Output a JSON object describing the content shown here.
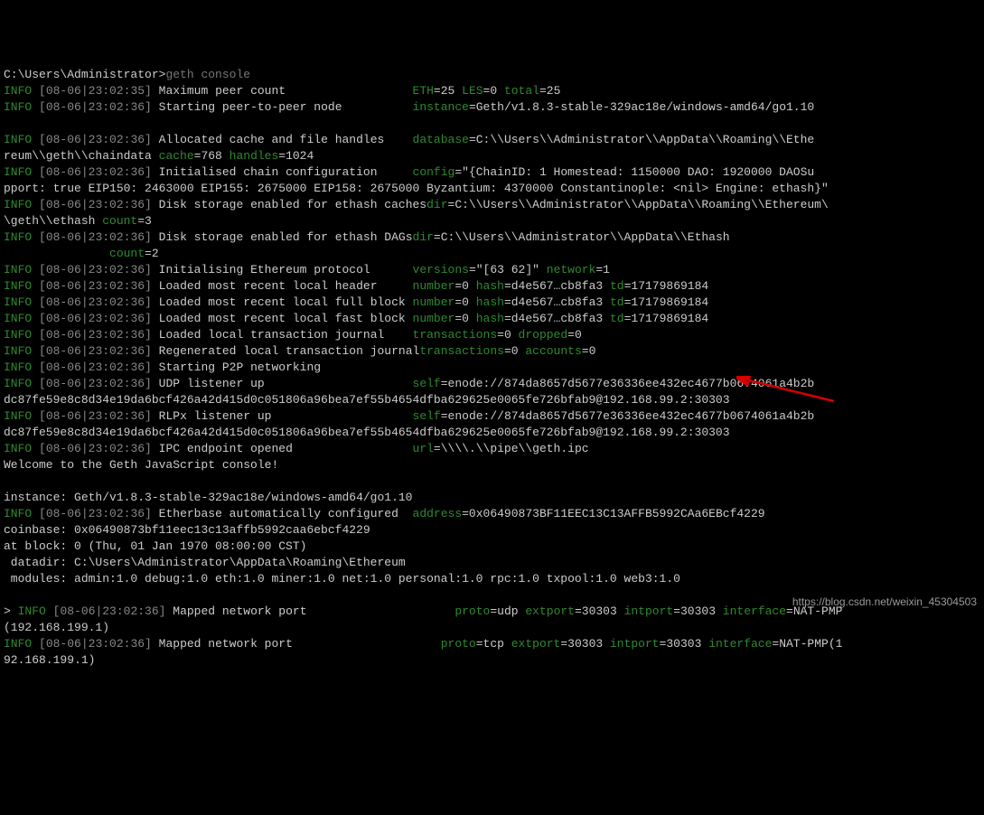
{
  "prompt": "C:\\Users\\Administrator>",
  "command": "geth console",
  "lines": [
    {
      "lvl": "INFO",
      "ts": "[08-06|23:02:35]",
      "msg": "Maximum peer count",
      "pad": 36,
      "kv": [
        [
          "ETH",
          "25"
        ],
        [
          "LES",
          "0"
        ],
        [
          "total",
          "25"
        ]
      ]
    },
    {
      "lvl": "INFO",
      "ts": "[08-06|23:02:36]",
      "msg": "Starting peer-to-peer node",
      "pad": 36,
      "kv": [
        [
          "instance",
          "Geth/v1.8.3-stable-329ac18e/windows-amd64/go1.10"
        ]
      ]
    },
    {
      "blank": true
    },
    {
      "lvl": "INFO",
      "ts": "[08-06|23:02:36]",
      "msg": "Allocated cache and file handles",
      "pad": 36,
      "kv": [
        [
          "database",
          "C:\\\\Users\\\\Administrator\\\\AppData\\\\Roaming\\\\Ethe"
        ]
      ],
      "wrap": "reum\\\\geth\\\\chaindata ",
      "wrapkv": [
        [
          "cache",
          "768"
        ],
        [
          "handles",
          "1024"
        ]
      ]
    },
    {
      "lvl": "INFO",
      "ts": "[08-06|23:02:36]",
      "msg": "Initialised chain configuration",
      "pad": 36,
      "kv": [
        [
          "config",
          "\"{ChainID: 1 Homestead: 1150000 DAO: 1920000 DAOSu"
        ]
      ],
      "wrap": "pport: true EIP150: 2463000 EIP155: 2675000 EIP158: 2675000 Byzantium: 4370000 Constantinople: <nil> Engine: ethash}\""
    },
    {
      "lvl": "INFO",
      "ts": "[08-06|23:02:36]",
      "msg": "Disk storage enabled for ethash caches",
      "pad": 36,
      "kv": [
        [
          "dir",
          "C:\\\\Users\\\\Administrator\\\\AppData\\\\Roaming\\\\Ethereum\\"
        ]
      ],
      "wrap": "\\geth\\\\ethash ",
      "wrapkv": [
        [
          "count",
          "3"
        ]
      ]
    },
    {
      "lvl": "INFO",
      "ts": "[08-06|23:02:36]",
      "msg": "Disk storage enabled for ethash DAGs",
      "pad": 36,
      "kv": [
        [
          "dir",
          "C:\\\\Users\\\\Administrator\\\\AppData\\\\Ethash"
        ]
      ],
      "wrap": "               ",
      "wrapkv": [
        [
          "count",
          "2"
        ]
      ]
    },
    {
      "lvl": "INFO",
      "ts": "[08-06|23:02:36]",
      "msg": "Initialising Ethereum protocol",
      "pad": 36,
      "kv": [
        [
          "versions",
          "\"[63 62]\""
        ],
        [
          "network",
          "1"
        ]
      ]
    },
    {
      "lvl": "INFO",
      "ts": "[08-06|23:02:36]",
      "msg": "Loaded most recent local header",
      "pad": 36,
      "kv": [
        [
          "number",
          "0"
        ],
        [
          "hash",
          "d4e567…cb8fa3"
        ],
        [
          "td",
          "17179869184"
        ]
      ]
    },
    {
      "lvl": "INFO",
      "ts": "[08-06|23:02:36]",
      "msg": "Loaded most recent local full block",
      "pad": 36,
      "kv": [
        [
          "number",
          "0"
        ],
        [
          "hash",
          "d4e567…cb8fa3"
        ],
        [
          "td",
          "17179869184"
        ]
      ]
    },
    {
      "lvl": "INFO",
      "ts": "[08-06|23:02:36]",
      "msg": "Loaded most recent local fast block",
      "pad": 36,
      "kv": [
        [
          "number",
          "0"
        ],
        [
          "hash",
          "d4e567…cb8fa3"
        ],
        [
          "td",
          "17179869184"
        ]
      ]
    },
    {
      "lvl": "INFO",
      "ts": "[08-06|23:02:36]",
      "msg": "Loaded local transaction journal",
      "pad": 36,
      "kv": [
        [
          "transactions",
          "0"
        ],
        [
          "dropped",
          "0"
        ]
      ]
    },
    {
      "lvl": "INFO",
      "ts": "[08-06|23:02:36]",
      "msg": "Regenerated local transaction journal",
      "pad": 36,
      "kv": [
        [
          "transactions",
          "0"
        ],
        [
          "accounts",
          "0"
        ]
      ]
    },
    {
      "lvl": "INFO",
      "ts": "[08-06|23:02:36]",
      "msg": "Starting P2P networking",
      "pad": 36,
      "kv": []
    },
    {
      "lvl": "INFO",
      "ts": "[08-06|23:02:36]",
      "msg": "UDP listener up",
      "pad": 36,
      "kv": [
        [
          "self",
          "enode://874da8657d5677e36336ee432ec4677b0674061a4b2b"
        ]
      ],
      "wrap": "dc87fe59e8c8d34e19da6bcf426a42d415d0c051806a96bea7ef55b4654dfba629625e0065fe726bfab9@192.168.99.2:30303"
    },
    {
      "lvl": "INFO",
      "ts": "[08-06|23:02:36]",
      "msg": "RLPx listener up",
      "pad": 36,
      "kv": [
        [
          "self",
          "enode://874da8657d5677e36336ee432ec4677b0674061a4b2b"
        ]
      ],
      "wrap": "dc87fe59e8c8d34e19da6bcf426a42d415d0c051806a96bea7ef55b4654dfba629625e0065fe726bfab9@192.168.99.2:30303"
    },
    {
      "lvl": "INFO",
      "ts": "[08-06|23:02:36]",
      "msg": "IPC endpoint opened",
      "pad": 36,
      "kv": [
        [
          "url",
          "\\\\\\\\.\\\\pipe\\\\geth.ipc"
        ]
      ]
    }
  ],
  "welcome": "Welcome to the Geth JavaScript console!",
  "console_lines": [
    "",
    "instance: Geth/v1.8.3-stable-329ac18e/windows-amd64/go1.10"
  ],
  "etherbase": {
    "lvl": "INFO",
    "ts": "[08-06|23:02:36]",
    "msg": "Etherbase automatically configured",
    "pad": 36,
    "kv": [
      [
        "address",
        "0x06490873BF11EEC13C13AFFB5992CAa6EBcf4229"
      ]
    ]
  },
  "after_eth": [
    "coinbase: 0x06490873bf11eec13c13affb5992caa6ebcf4229",
    "at block: 0 (Thu, 01 Jan 1970 08:00:00 CST)",
    " datadir: C:\\Users\\Administrator\\AppData\\Roaming\\Ethereum",
    " modules: admin:1.0 debug:1.0 eth:1.0 miner:1.0 net:1.0 personal:1.0 rpc:1.0 txpool:1.0 web3:1.0",
    ""
  ],
  "mapped": [
    {
      "prefix": "> ",
      "lvl": "INFO",
      "ts": "[08-06|23:02:36]",
      "msg": "Mapped network port",
      "pad": 40,
      "kv": [
        [
          "proto",
          "udp"
        ],
        [
          "extport",
          "30303"
        ],
        [
          "intport",
          "30303"
        ],
        [
          "interface",
          "NAT-PMP"
        ]
      ],
      "wrap": "(192.168.199.1)"
    },
    {
      "prefix": "",
      "lvl": "INFO",
      "ts": "[08-06|23:02:36]",
      "msg": "Mapped network port",
      "pad": 40,
      "kv": [
        [
          "proto",
          "tcp"
        ],
        [
          "extport",
          "30303"
        ],
        [
          "intport",
          "30303"
        ],
        [
          "interface",
          "NAT-PMP(1"
        ]
      ],
      "wrap": "92.168.199.1)"
    }
  ],
  "watermark": "https://blog.csdn.net/weixin_45304503"
}
